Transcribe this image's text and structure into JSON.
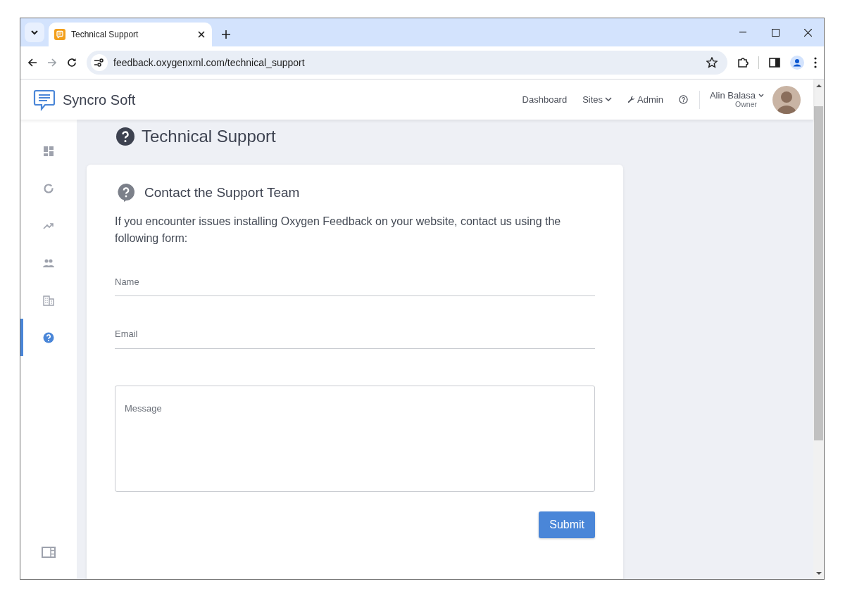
{
  "browser": {
    "tab_title": "Technical Support",
    "url": "feedback.oxygenxml.com/technical_support"
  },
  "header": {
    "brand": "Syncro Soft",
    "nav": [
      {
        "kind": "link",
        "label": "Dashboard"
      },
      {
        "kind": "dropdown",
        "label": "Sites"
      },
      {
        "kind": "tool",
        "label": "Admin"
      },
      {
        "kind": "help"
      }
    ],
    "user": {
      "name": "Alin Balasa",
      "role": "Owner"
    }
  },
  "sidebar": {
    "items": [
      {
        "selected": false
      },
      {
        "selected": false
      },
      {
        "selected": false
      },
      {
        "selected": false
      },
      {
        "selected": false
      },
      {
        "selected": true
      }
    ]
  },
  "page_title": "Technical Support",
  "card": {
    "title": "Contact the Support Team",
    "intro": "If you encounter issues installing Oxygen Feedback on your website, contact us using the following form:",
    "fields": [
      {
        "kind": "line",
        "placeholder": "Name"
      },
      {
        "kind": "line",
        "placeholder": "Email"
      },
      {
        "kind": "area",
        "placeholder": "Message"
      }
    ],
    "submit": "Submit"
  }
}
